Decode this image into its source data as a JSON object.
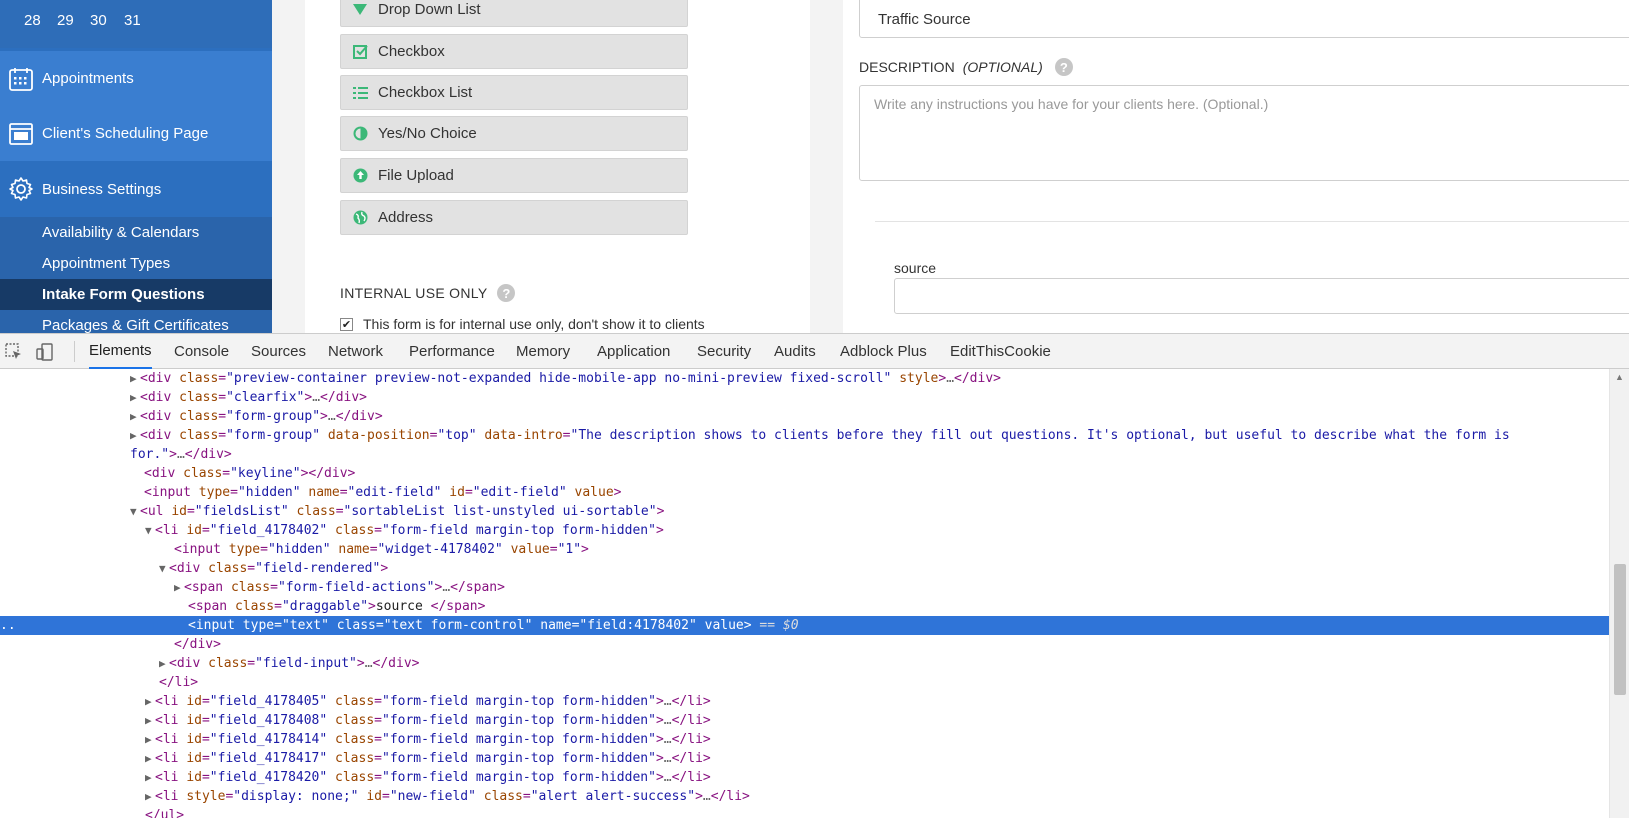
{
  "sidebar": {
    "calendar_days": [
      "28",
      "29",
      "30",
      "31"
    ],
    "nav": [
      {
        "label": "Appointments",
        "icon": "calendar-icon"
      },
      {
        "label": "Client's Scheduling Page",
        "icon": "browser-window-icon"
      },
      {
        "label": "Business Settings",
        "icon": "gear-icon"
      }
    ],
    "sub_items": [
      "Availability & Calendars",
      "Appointment Types",
      "Intake Form Questions",
      "Packages & Gift Certificates"
    ]
  },
  "field_types": [
    {
      "label": "Drop Down List",
      "icon": "triangle-down-icon"
    },
    {
      "label": "Checkbox",
      "icon": "checkbox-icon"
    },
    {
      "label": "Checkbox List",
      "icon": "list-icon"
    },
    {
      "label": "Yes/No Choice",
      "icon": "half-circle-icon"
    },
    {
      "label": "File Upload",
      "icon": "upload-icon"
    },
    {
      "label": "Address",
      "icon": "globe-icon"
    }
  ],
  "internal_use": {
    "title": "INTERNAL USE ONLY",
    "help": "?",
    "checkbox_label": "This form is for internal use only, don't show it to clients",
    "checked": true
  },
  "form": {
    "title_value": "Traffic Source",
    "description_label": "DESCRIPTION",
    "description_optional": "(OPTIONAL)",
    "description_placeholder": "Write any instructions you have for your clients here. (Optional.)",
    "field_label": "source"
  },
  "devtools": {
    "tabs": [
      "Elements",
      "Console",
      "Sources",
      "Network",
      "Performance",
      "Memory",
      "Application",
      "Security",
      "Audits",
      "Adblock Plus",
      "EditThisCookie"
    ],
    "active_tab": "Elements",
    "selected_suffix": " == $0",
    "gutter_mark": "..",
    "colors": {
      "tag": "#881280",
      "attr_name": "#994500",
      "attr_value": "#1a1aa6",
      "selection": "#2f74d8"
    }
  }
}
